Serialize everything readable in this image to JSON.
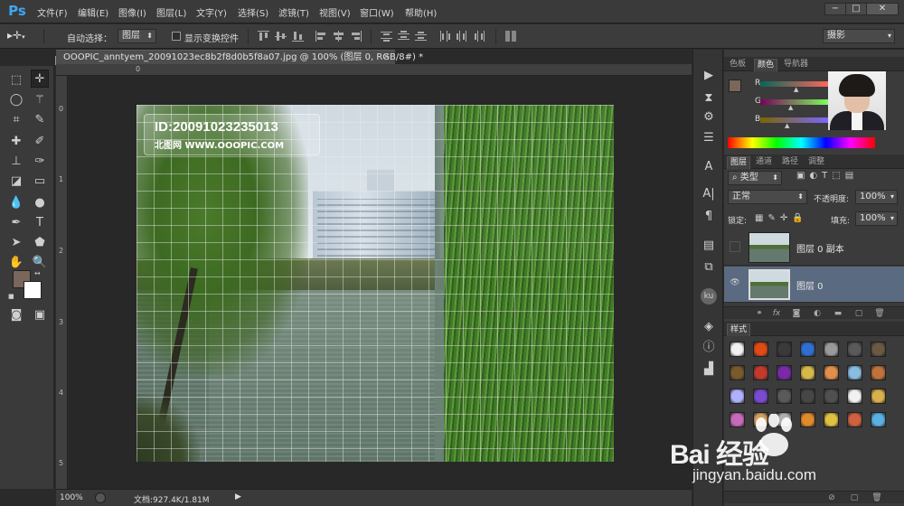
{
  "app": {
    "logo": "Ps"
  },
  "menu": [
    "文件(F)",
    "编辑(E)",
    "图像(I)",
    "图层(L)",
    "文字(Y)",
    "选择(S)",
    "滤镜(T)",
    "视图(V)",
    "窗口(W)",
    "帮助(H)"
  ],
  "window_controls": {
    "minimize": "−",
    "maximize": "□",
    "close": "✕"
  },
  "options": {
    "auto_select_label": "自动选择：",
    "auto_select_checked": true,
    "auto_select_target": "图层",
    "show_transform_label": "显示变换控件",
    "show_transform_checked": false,
    "workspace": "摄影"
  },
  "document": {
    "tab_title": "OOOPIC_anntyem_20091023ec8b2f8d0b5f8a07.jpg @ 100% (图层 0, RGB/8#) *",
    "tab_close": "×",
    "watermark_id": "ID:20091023235013",
    "watermark_site": "北图网  WWW.OOOPIC.COM"
  },
  "rulers": {
    "top": [
      "0"
    ],
    "left": [
      "0",
      "1",
      "2",
      "3",
      "4",
      "5"
    ]
  },
  "status": {
    "zoom": "100%",
    "doc_info": "文档:927.4K/1.81M"
  },
  "color_panel": {
    "tabs": [
      "色板",
      "颜色",
      "导航器"
    ],
    "active_tab": "颜色",
    "labels": [
      "R",
      "G",
      "B"
    ],
    "foreground": "#7a665b"
  },
  "layers_panel": {
    "tabs": [
      "图层",
      "通道",
      "路径",
      "调整"
    ],
    "active_tab": "图层",
    "filter": "类型",
    "blend_mode": "正常",
    "opacity_label": "不透明度:",
    "opacity": "100%",
    "lock_label": "锁定:",
    "fill_label": "填充:",
    "fill": "100%",
    "layers": [
      {
        "name": "图层 0 副本",
        "selected": false,
        "visible": false
      },
      {
        "name": "图层 0",
        "selected": true,
        "visible": true
      }
    ],
    "footer": [
      "link-icon",
      "fx",
      "mask-icon",
      "adjust-icon",
      "folder-icon",
      "new-icon",
      "trash-icon"
    ]
  },
  "styles_panel": {
    "title": "样式",
    "swatches": [
      "#f1f1f1",
      "#e04a14",
      "#3a3a3a",
      "#2f6fd1",
      "#9a9a9a",
      "#5a5a5a",
      "#6a5a44",
      "#7a5a2a",
      "#c33a2a",
      "#7a2aa8",
      "#d6b84a",
      "#e0904a",
      "#8abbe0",
      "#c0723a",
      "#b0b0ff",
      "#7a4ad0",
      "#5a5a5a",
      "#474747",
      "#505050",
      "#f1f1f1",
      "#d9b04a",
      "#c86aba",
      "#d0a060",
      "#b0b0b0",
      "#e08a2a",
      "#e0c040",
      "#d06040",
      "#5ab0e0"
    ]
  },
  "branding": {
    "baidu_logo": "Bai  经验",
    "baidu_url": "jingyan.baidu.com"
  }
}
